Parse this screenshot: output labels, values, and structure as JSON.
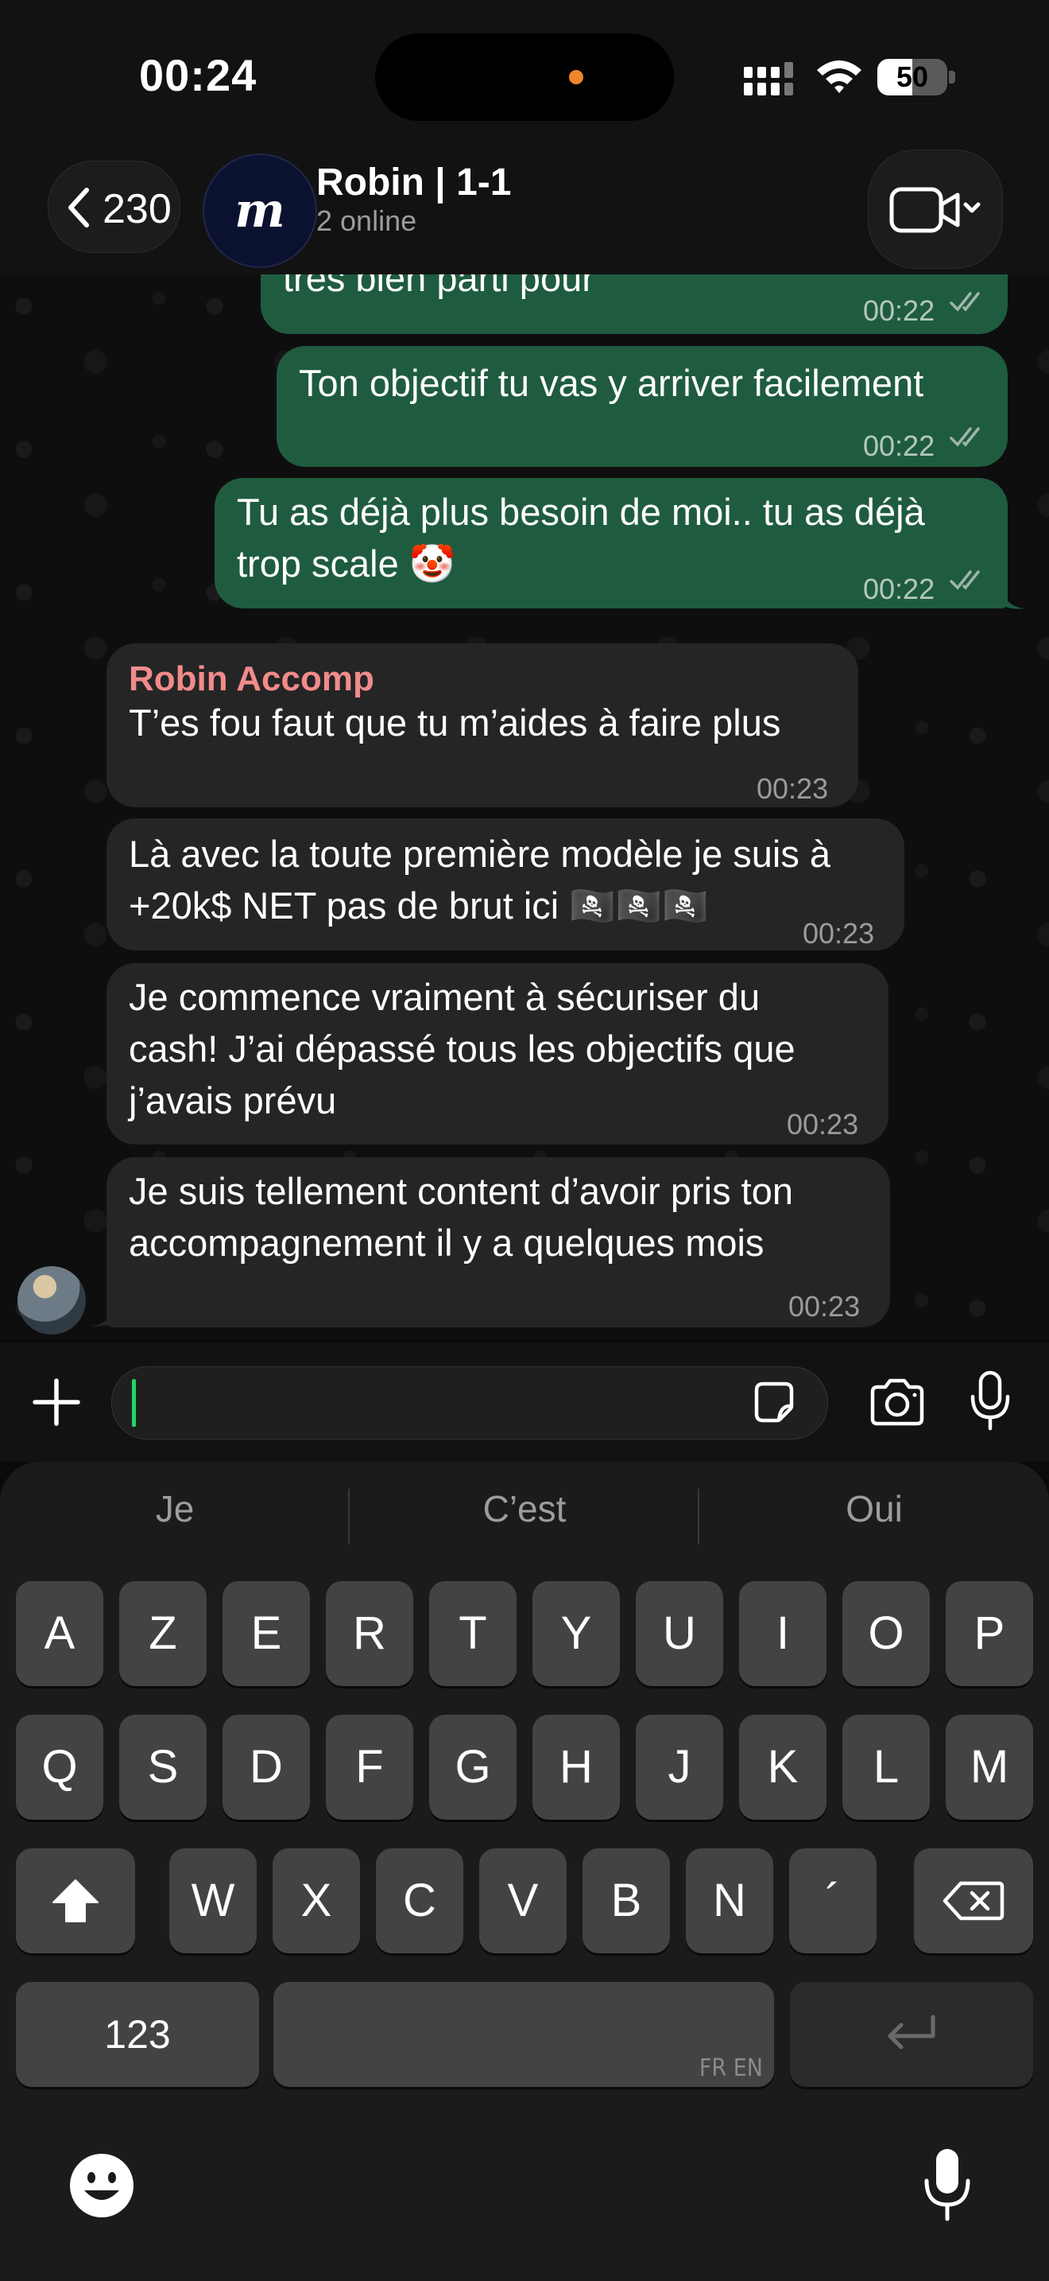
{
  "status_bar": {
    "time": "00:24",
    "battery_level": "50",
    "battery_fraction": 0.5
  },
  "header": {
    "back_count": "230",
    "avatar_letter": "m",
    "title": "Robin | 1-1",
    "subtitle": "2 online"
  },
  "messages": [
    {
      "direction": "outgoing",
      "text": "très bien parti pour",
      "time": "00:22",
      "read": true
    },
    {
      "direction": "outgoing",
      "text": "Ton objectif tu vas y arriver facilement",
      "time": "00:22",
      "read": true
    },
    {
      "direction": "outgoing",
      "text": "Tu as déjà plus besoin de moi.. tu as déjà\ntrop scale 🤡",
      "time": "00:22",
      "read": true
    },
    {
      "direction": "incoming",
      "sender": "Robin Accomp",
      "text": "T’es fou faut que tu m’aides à faire plus",
      "time": "00:23"
    },
    {
      "direction": "incoming",
      "text": "Là avec la toute première modèle je suis à\n+20k$ NET pas de brut ici 🏴‍☠️🏴‍☠️🏴‍☠️",
      "time": "00:23"
    },
    {
      "direction": "incoming",
      "text": "Je commence vraiment à sécuriser du\ncash! J’ai dépassé tous les objectifs que\nj’avais prévu",
      "time": "00:23"
    },
    {
      "direction": "incoming",
      "text": "Je suis tellement content d’avoir pris ton\naccompagnement il y a quelques mois",
      "time": "00:23"
    }
  ],
  "composer": {
    "input_value": "",
    "placeholder": ""
  },
  "keyboard": {
    "suggestions": [
      "Je",
      "C’est",
      "Oui"
    ],
    "row1": [
      "A",
      "Z",
      "E",
      "R",
      "T",
      "Y",
      "U",
      "I",
      "O",
      "P"
    ],
    "row2": [
      "Q",
      "S",
      "D",
      "F",
      "G",
      "H",
      "J",
      "K",
      "L",
      "M"
    ],
    "row3": [
      "W",
      "X",
      "C",
      "V",
      "B",
      "N",
      "´"
    ],
    "numbers_key": "123",
    "space_languages": "FR EN"
  },
  "icons": {
    "back": "chevron-left-icon",
    "video": "video-camera-icon",
    "plus": "plus-icon",
    "sticker": "sticker-icon",
    "camera": "camera-icon",
    "mic": "microphone-icon",
    "shift": "shift-icon",
    "delete": "backspace-icon",
    "return": "return-icon",
    "emoji": "emoji-icon",
    "dictation": "dictation-icon"
  },
  "colors": {
    "outgoing_bubble": "#1f5c3f",
    "incoming_bubble": "#252525",
    "sender_name": "#f28b8b",
    "read_ticks": "#9fb6aa",
    "cursor": "#25d366",
    "camera_indicator": "#f0872a"
  }
}
